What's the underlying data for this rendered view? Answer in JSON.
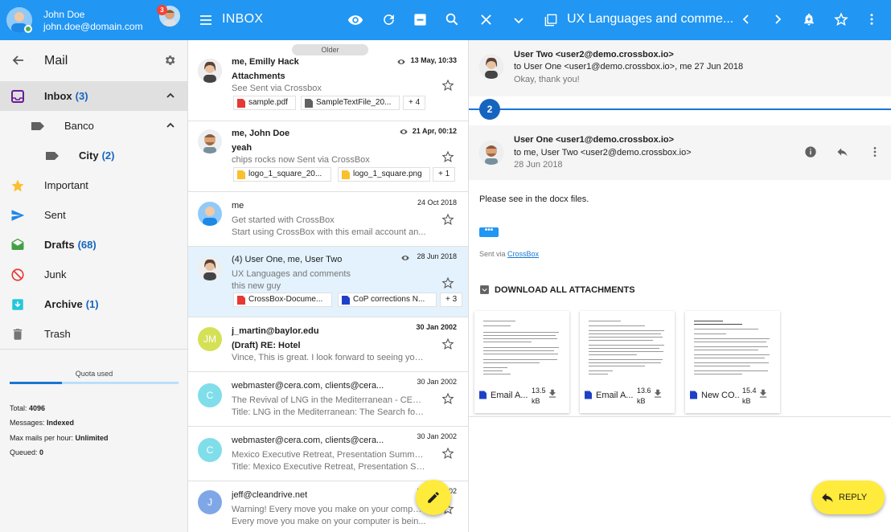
{
  "account": {
    "name": "John Doe",
    "email": "john.doe@domain.com",
    "notifications": "3"
  },
  "sidebar": {
    "title": "Mail",
    "items": [
      {
        "label": "Inbox",
        "count": "(3)",
        "icon": "inbox-icon"
      },
      {
        "label": "Banco",
        "count": "",
        "icon": "label-icon"
      },
      {
        "label": "City",
        "count": "(2)",
        "icon": "label-icon"
      },
      {
        "label": "Important",
        "count": "",
        "icon": "star-icon"
      },
      {
        "label": "Sent",
        "count": "",
        "icon": "send-icon"
      },
      {
        "label": "Drafts",
        "count": "(68)",
        "icon": "drafts-icon"
      },
      {
        "label": "Junk",
        "count": "",
        "icon": "block-icon"
      },
      {
        "label": "Archive",
        "count": "(1)",
        "icon": "archive-icon"
      },
      {
        "label": "Trash",
        "count": "",
        "icon": "trash-icon"
      }
    ],
    "quota": {
      "label": "Quota used",
      "fraction": 0.31,
      "total_label": "Total:",
      "total": "4096",
      "messages_label": "Messages:",
      "messages": "Indexed",
      "maxmails_label": "Max mails per hour:",
      "maxmails": "Unlimited",
      "queued_label": "Queued:",
      "queued": "0"
    }
  },
  "list": {
    "title": "INBOX",
    "group": "Older",
    "messages": [
      {
        "from": "me, Emilly Hack",
        "date": "13 May, 10:33",
        "subject": "Attachments",
        "preview": "See Sent via Crossbox",
        "preview2": "",
        "unread": true,
        "attachments": [
          "sample.pdf",
          "SampleTextFile_20..."
        ],
        "more": "+ 4"
      },
      {
        "from": "me, John Doe",
        "date": "21 Apr, 00:12",
        "subject": "yeah",
        "preview": "chips rocks now Sent via CrossBox",
        "preview2": "",
        "unread": true,
        "attachments": [
          "logo_1_square_20...",
          "logo_1_square.png"
        ],
        "more": "+ 1"
      },
      {
        "from": "me",
        "date": "24 Oct 2018",
        "subject": "",
        "preview": "Get started with CrossBox",
        "preview2": "Start using CrossBox with this email account an...",
        "unread": false
      },
      {
        "from": "(4) User One, me, User Two",
        "date": "28 Jun 2018",
        "subject": "",
        "preview": "UX Languages and comments",
        "preview2": "this new guy",
        "unread": false,
        "attachments": [
          "CrossBox-Docume...",
          "CoP corrections N..."
        ],
        "more": "+ 3"
      },
      {
        "from": "j_martin@baylor.edu",
        "date": "30 Jan 2002",
        "subject": "(Draft) RE: Hotel",
        "preview": "Vince, This is great. I look forward to seeing you...",
        "preview2": "",
        "unread": true,
        "initials": "JM"
      },
      {
        "from": "webmaster@cera.com, clients@cera....",
        "date": "30 Jan 2002",
        "subject": "",
        "preview": "The Revival of LNG in the Mediterranean - CERA...",
        "preview2": "Title: LNG in the Mediterranean: The Search for ...",
        "unread": false,
        "initials": "C"
      },
      {
        "from": "webmaster@cera.com, clients@cera....",
        "date": "30 Jan 2002",
        "subject": "",
        "preview": "Mexico Executive Retreat, Presentation Summar...",
        "preview2": "Title: Mexico Executive Retreat, Presentation Su...",
        "unread": false,
        "initials": "C"
      },
      {
        "from": "jeff@cleandrive.net",
        "date": "30 Jan 2002",
        "subject": "",
        "preview": "Warning! Every move you make on your comput...",
        "preview2": "Every move you make on your computer is bein...",
        "unread": false,
        "initials": "J"
      }
    ]
  },
  "reader": {
    "title": "UX Languages and comme...",
    "message1": {
      "from": "User Two <user2@demo.crossbox.io>",
      "to": "to User One <user1@demo.crossbox.io>, me 27 Jun 2018",
      "snippet": "Okay, thank you!"
    },
    "thread_count": "2",
    "message2": {
      "from": "User One <user1@demo.crossbox.io>",
      "to": "to me, User Two <user2@demo.crossbox.io>",
      "date": "28 Jun 2018"
    },
    "body": "Please see in the docx files.",
    "ellipsis": "•••",
    "sent_via_prefix": "Sent via",
    "sent_via_link": "CrossBox",
    "download_all": "DOWNLOAD ALL ATTACHMENTS",
    "attachments": [
      {
        "name": "Email A...",
        "size": "13.5 kB"
      },
      {
        "name": "Email A...",
        "size": "13.6 kB"
      },
      {
        "name": "New CO...",
        "size": "15.4 kB"
      }
    ],
    "reply_label": "REPLY"
  },
  "colors": {
    "primary": "#2196f3",
    "accent": "#ffeb3b",
    "link": "#1565c0"
  }
}
